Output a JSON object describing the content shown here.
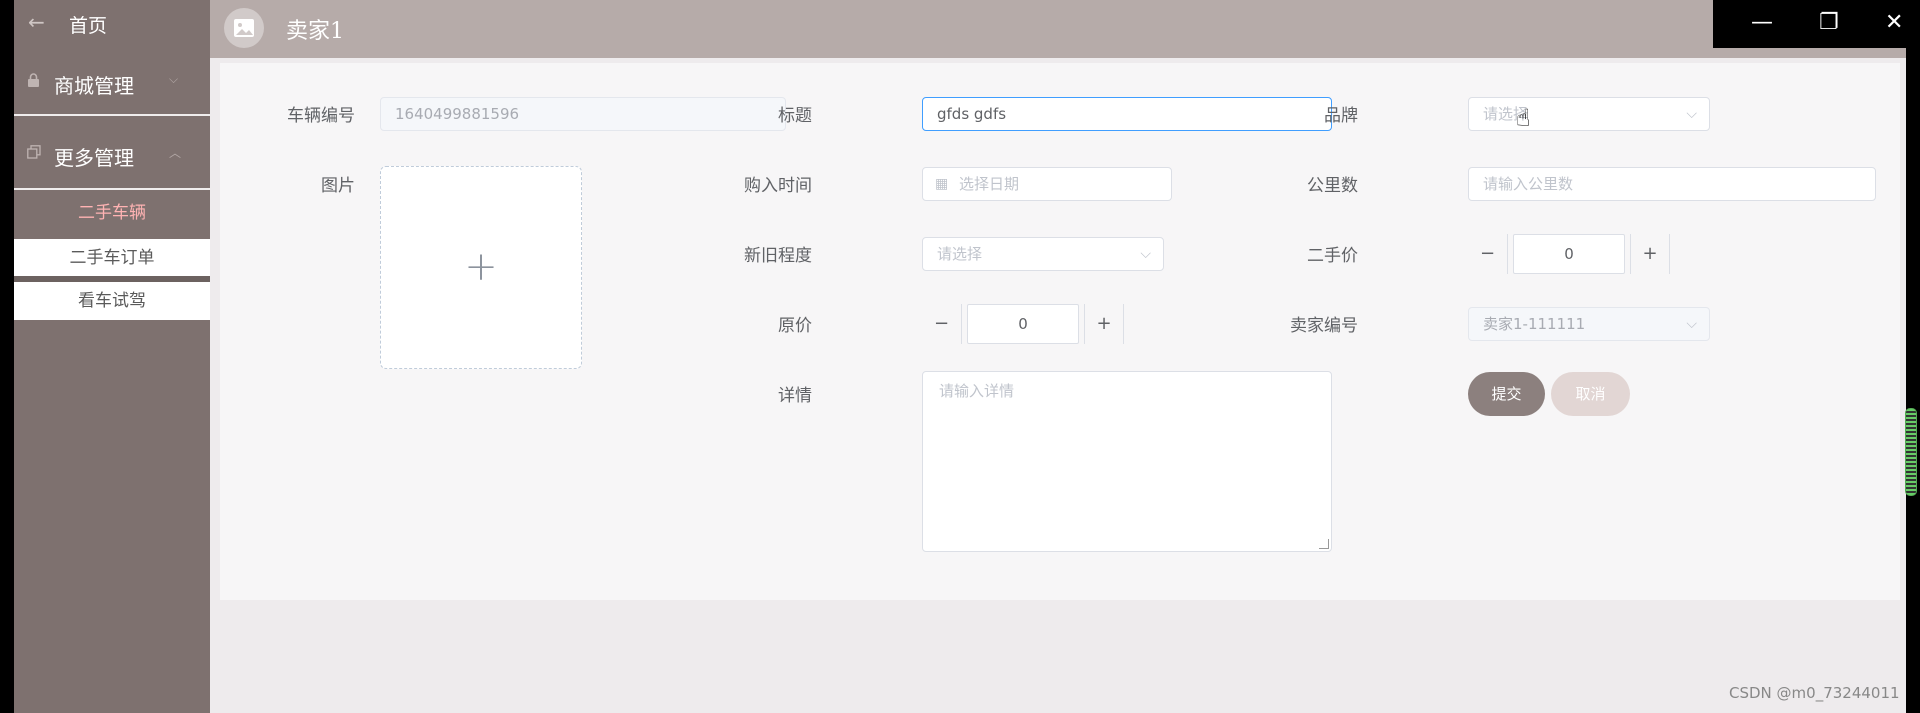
{
  "sidebar": {
    "home_label": "首页",
    "groups": [
      {
        "label": "商城管理"
      },
      {
        "label": "更多管理"
      }
    ],
    "sub_items": [
      {
        "label": "二手车辆"
      },
      {
        "label": "二手车订单"
      },
      {
        "label": "看车试驾"
      }
    ]
  },
  "header": {
    "title": "卖家1"
  },
  "form": {
    "vehicle_no": {
      "label": "车辆编号",
      "value": "1640499881596"
    },
    "title": {
      "label": "标题",
      "value": "gfds gdfs"
    },
    "brand": {
      "label": "品牌",
      "placeholder": "请选择"
    },
    "image": {
      "label": "图片"
    },
    "purchase_time": {
      "label": "购入时间",
      "placeholder": "选择日期"
    },
    "mileage": {
      "label": "公里数",
      "placeholder": "请输入公里数"
    },
    "condition": {
      "label": "新旧程度",
      "placeholder": "请选择"
    },
    "used_price": {
      "label": "二手价",
      "value": "0"
    },
    "original_price": {
      "label": "原价",
      "value": "0"
    },
    "seller_no": {
      "label": "卖家编号",
      "value": "卖家1-111111"
    },
    "details": {
      "label": "详情",
      "placeholder": "请输入详情"
    },
    "submit_label": "提交",
    "cancel_label": "取消"
  },
  "watermark": "CSDN @m0_73244011"
}
